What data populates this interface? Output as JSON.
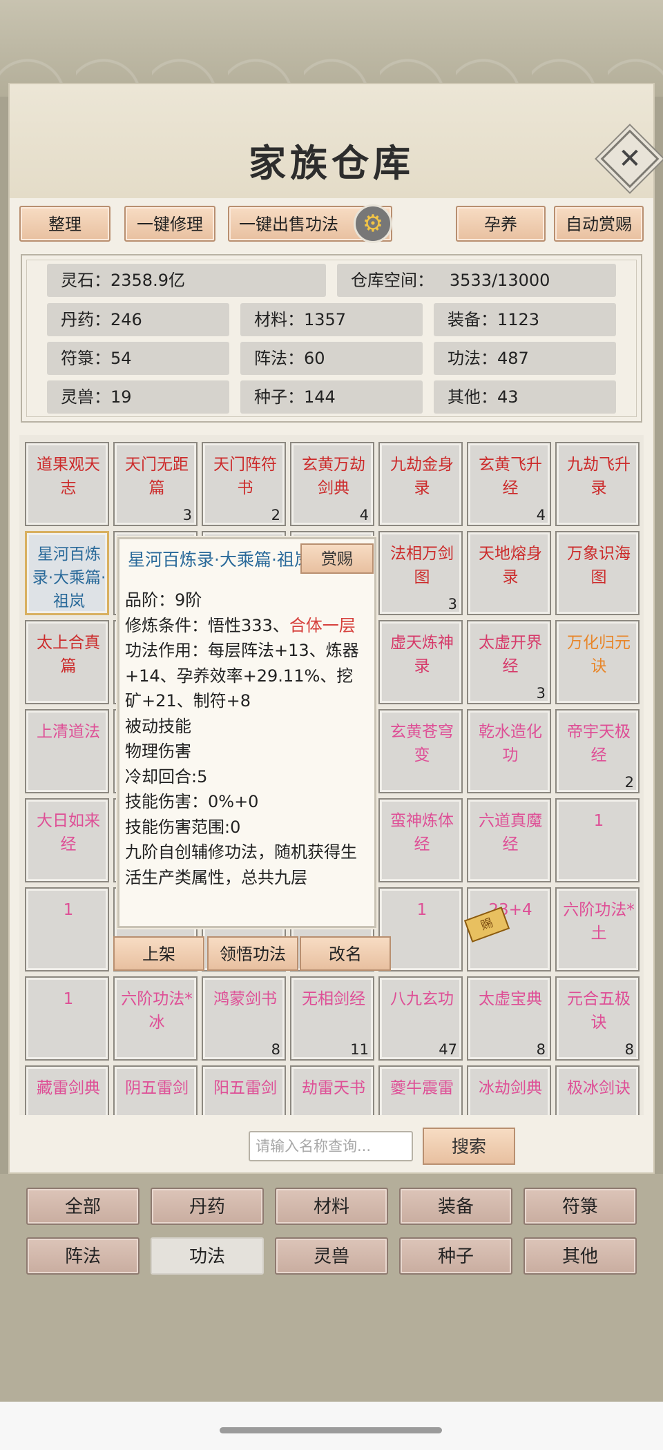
{
  "title": "家族仓库",
  "toolbar": {
    "organize": "整理",
    "repair_all": "一键修理",
    "sell_skills": "一键出售功法",
    "nurture": "孕养",
    "auto_reward": "自动赏赐"
  },
  "stats": {
    "spirit_stones": "灵石：2358.9亿",
    "space_label": "仓库空间：",
    "space_value": "3533/13000",
    "pills": "丹药：246",
    "materials": "材料：1357",
    "equipment": "装备：1123",
    "talismans": "符箓：54",
    "formations": "阵法：60",
    "skills": "功法：487",
    "beasts": "灵兽：19",
    "seeds": "种子：144",
    "others": "其他：43"
  },
  "grid": [
    [
      {
        "name": "道果观天志",
        "count": "",
        "color": "#cc2b2b"
      },
      {
        "name": "天门无距篇",
        "count": "3",
        "color": "#cc2b2b"
      },
      {
        "name": "天门阵符书",
        "count": "2",
        "color": "#cc2b2b"
      },
      {
        "name": "玄黄万劫剑典",
        "count": "4",
        "color": "#cc2b2b"
      },
      {
        "name": "九劫金身录",
        "count": "",
        "color": "#cc2b2b"
      },
      {
        "name": "玄黄飞升经",
        "count": "4",
        "color": "#cc2b2b"
      },
      {
        "name": "九劫飞升录",
        "count": "",
        "color": "#cc2b2b"
      }
    ],
    [
      {
        "name": "星河百炼录·大乘篇·祖岚",
        "count": "",
        "color": "#2a6a9a"
      },
      {
        "name": "",
        "count": "",
        "color": "#cc2b2b"
      },
      {
        "name": "",
        "count": "",
        "color": "#cc2b2b"
      },
      {
        "name": "",
        "count": "",
        "color": "#cc2b2b"
      },
      {
        "name": "法相万剑图",
        "count": "3",
        "color": "#cc2b2b"
      },
      {
        "name": "天地熔身录",
        "count": "",
        "color": "#cc2b2b"
      },
      {
        "name": "万象识海图",
        "count": "",
        "color": "#cc2b2b"
      }
    ],
    [
      {
        "name": "太上合真篇",
        "count": "",
        "color": "#cc2b2b"
      },
      {
        "name": "",
        "count": "",
        "color": "#cc2b2b"
      },
      {
        "name": "",
        "count": "",
        "color": "#cc2b2b"
      },
      {
        "name": "",
        "count": "",
        "color": "#cc2b2b"
      },
      {
        "name": "虚天炼神录",
        "count": "",
        "color": "#d63a6a"
      },
      {
        "name": "太虚开界经",
        "count": "3",
        "color": "#d63a6a"
      },
      {
        "name": "万化归元诀",
        "count": "",
        "color": "#e8862a"
      }
    ],
    [
      {
        "name": "上清道法",
        "count": "",
        "color": "#de4f96"
      },
      {
        "name": "",
        "count": "",
        "color": "#de4f96"
      },
      {
        "name": "",
        "count": "",
        "color": "#de4f96"
      },
      {
        "name": "",
        "count": "",
        "color": "#de4f96"
      },
      {
        "name": "玄黄苍穹变",
        "count": "",
        "color": "#de4f96"
      },
      {
        "name": "乾水造化功",
        "count": "",
        "color": "#de4f96"
      },
      {
        "name": "帝宇天极经",
        "count": "2",
        "color": "#de4f96"
      }
    ],
    [
      {
        "name": "大日如来经",
        "count": "",
        "color": "#de4f96"
      },
      {
        "name": "",
        "count": "",
        "color": "#de4f96"
      },
      {
        "name": "",
        "count": "",
        "color": "#de4f96"
      },
      {
        "name": "",
        "count": "",
        "color": "#de4f96"
      },
      {
        "name": "蛮神炼体经",
        "count": "",
        "color": "#de4f96"
      },
      {
        "name": "六道真魔经",
        "count": "",
        "color": "#de4f96"
      },
      {
        "name": "1",
        "count": "",
        "color": "#de4f96"
      }
    ],
    [
      {
        "name": "1",
        "count": "",
        "color": "#de4f96"
      },
      {
        "name": "",
        "count": "",
        "color": "#de4f96"
      },
      {
        "name": "",
        "count": "",
        "color": "#de4f96"
      },
      {
        "name": "",
        "count": "",
        "color": "#de4f96"
      },
      {
        "name": "1",
        "count": "",
        "color": "#de4f96"
      },
      {
        "name": "23+4",
        "count": "",
        "color": "#de4f96"
      },
      {
        "name": "六阶功法*土",
        "count": "",
        "color": "#de4f96"
      }
    ],
    [
      {
        "name": "1",
        "count": "",
        "color": "#de4f96"
      },
      {
        "name": "六阶功法*冰",
        "count": "",
        "color": "#de4f96"
      },
      {
        "name": "鸿蒙剑书",
        "count": "8",
        "color": "#de4f96"
      },
      {
        "name": "无相剑经",
        "count": "11",
        "color": "#de4f96"
      },
      {
        "name": "八九玄功",
        "count": "47",
        "color": "#de4f96"
      },
      {
        "name": "太虚宝典",
        "count": "8",
        "color": "#de4f96"
      },
      {
        "name": "元合五极诀",
        "count": "8",
        "color": "#de4f96"
      }
    ],
    [
      {
        "name": "藏雷剑典",
        "count": "",
        "color": "#de4f96"
      },
      {
        "name": "阴五雷剑",
        "count": "",
        "color": "#de4f96"
      },
      {
        "name": "阳五雷剑",
        "count": "",
        "color": "#de4f96"
      },
      {
        "name": "劫雷天书",
        "count": "",
        "color": "#de4f96"
      },
      {
        "name": "夔牛震雷",
        "count": "",
        "color": "#de4f96"
      },
      {
        "name": "冰劫剑典",
        "count": "",
        "color": "#de4f96"
      },
      {
        "name": "极冰剑诀",
        "count": "",
        "color": "#de4f96"
      }
    ]
  ],
  "popup": {
    "title": "星河百炼录·大乘篇·祖岚",
    "reward_button": "赏赐",
    "grade": "品阶：9阶",
    "condition_prefix": "修炼条件：悟性333、",
    "condition_red": "合体一层",
    "effect": "功法作用：每层阵法+13、炼器+14、孕养效率+29.11%、挖矿+21、制符+8",
    "passive": "被动技能",
    "damage_type": "物理伤害",
    "cooldown": "冷却回合:5",
    "skill_damage": "技能伤害：0%+0",
    "skill_range": "技能伤害范围:0",
    "description": "九阶自创辅修功法，随机获得生活生产类属性，总共九层",
    "actions": {
      "list": "上架",
      "comprehend": "领悟功法",
      "rename": "改名"
    }
  },
  "stamp_text": "赐",
  "search": {
    "placeholder": "请输入名称查询...",
    "button": "搜索"
  },
  "categories": [
    "全部",
    "丹药",
    "材料",
    "装备",
    "符箓",
    "阵法",
    "功法",
    "灵兽",
    "种子",
    "其他"
  ],
  "active_category": "功法"
}
